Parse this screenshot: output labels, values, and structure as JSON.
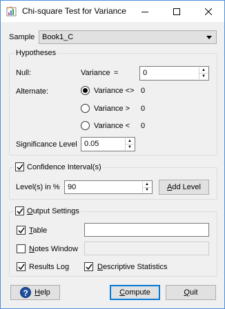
{
  "window": {
    "title": "Chi-square Test for Variance",
    "controls": [
      "minimize-icon",
      "maximize-icon",
      "close-icon"
    ]
  },
  "sample": {
    "label": "Sample",
    "value": "Book1_C"
  },
  "hypotheses": {
    "title": "Hypotheses",
    "null_label": "Null:",
    "variance_label": "Variance",
    "equals": "=",
    "null_value": "0",
    "alternate_label": "Alternate:",
    "alternatives": [
      {
        "label": "Variance <>",
        "value": "0",
        "selected": true
      },
      {
        "label": "Variance >",
        "value": "0",
        "selected": false
      },
      {
        "label": "Variance <",
        "value": "0",
        "selected": false
      }
    ],
    "significance_label": "Significance Level",
    "significance_value": "0.05"
  },
  "confidence": {
    "title": "Confidence Interval(s)",
    "checked": true,
    "levels_label": "Level(s) in %",
    "levels_value": "90",
    "add_level_label": "Add Level"
  },
  "output": {
    "title": "Output Settings",
    "checked": true,
    "table": {
      "label": "Table",
      "checked": true,
      "value": ""
    },
    "notes": {
      "label": "Notes Window",
      "checked": false,
      "value": ""
    },
    "results_log": {
      "label": "Results Log",
      "checked": true
    },
    "descriptive": {
      "label": "Descriptive Statistics",
      "checked": true
    }
  },
  "buttons": {
    "help": "Help",
    "compute": "Compute",
    "quit": "Quit"
  },
  "colors": {
    "accent": "#0078d7",
    "window_bg": "#f0f0f0",
    "frame": "#4a90d9"
  }
}
